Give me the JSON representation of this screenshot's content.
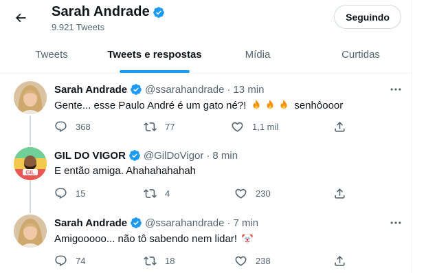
{
  "header": {
    "title": "Sarah Andrade",
    "subtitle": "9.921 Tweets",
    "follow_label": "Seguindo"
  },
  "tabs": [
    {
      "label": "Tweets",
      "active": false
    },
    {
      "label": "Tweets e respostas",
      "active": true
    },
    {
      "label": "Mídia",
      "active": false
    },
    {
      "label": "Curtidas",
      "active": false
    }
  ],
  "tweets": [
    {
      "name": "Sarah Andrade",
      "handle": "@ssarahandrade",
      "dot": "·",
      "time": "13 min",
      "text": "Gente... esse Paulo André é um gato né?!",
      "text_tail": "senhôooor",
      "emojis": [
        "fire",
        "fire",
        "fire"
      ],
      "replies": "368",
      "retweets": "77",
      "likes": "1,1 mil"
    },
    {
      "name": "GIL DO VIGOR",
      "handle": "@GilDoVigor",
      "dot": "·",
      "time": "8 min",
      "text": "E então amiga. Ahahahahahah",
      "replies": "15",
      "retweets": "4",
      "likes": "230"
    },
    {
      "name": "Sarah Andrade",
      "handle": "@ssarahandrade",
      "dot": "·",
      "time": "7 min",
      "text": "Amigooooo... não tô sabendo nem lidar!",
      "emojis": [
        "clown"
      ],
      "replies": "74",
      "retweets": "18",
      "likes": "238"
    }
  ],
  "colors": {
    "accent": "#1d9bf0",
    "text": "#0f1419",
    "muted": "#536471",
    "border": "#eff3f4"
  }
}
